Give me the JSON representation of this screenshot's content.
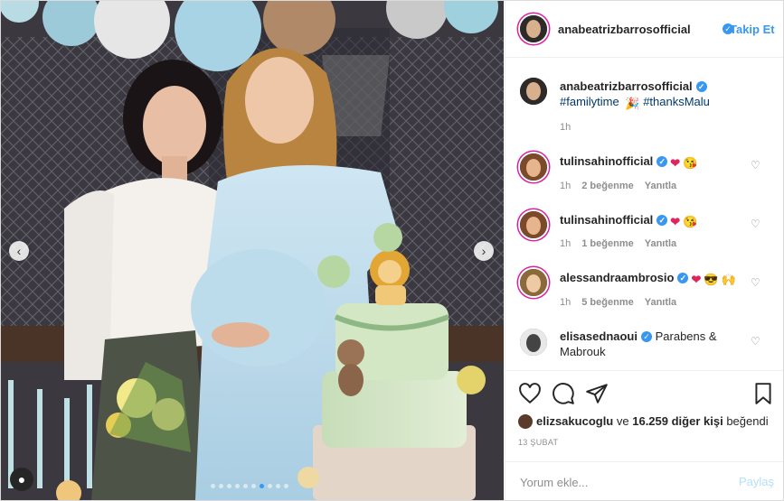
{
  "post": {
    "author": "anabeatrizbarrosofficial",
    "follow_label": "Takip Et",
    "caption_tags": [
      "#familytime",
      "#thanksMalu"
    ],
    "caption_time": "1h",
    "likes_user": "elizsakucoglu",
    "likes_middle": "ve",
    "likes_count": "16.259 diğer kişi",
    "likes_suffix": "beğendi",
    "date": "13 ŞUBAT",
    "comment_placeholder": "Yorum ekle...",
    "post_label": "Paylaş"
  },
  "comments": [
    {
      "user": "tulinsahinofficial",
      "time": "1h",
      "likes": "2 beğenme",
      "reply": "Yanıtla"
    },
    {
      "user": "tulinsahinofficial",
      "time": "1h",
      "likes": "1 beğenme",
      "reply": "Yanıtla"
    },
    {
      "user": "alessandraambrosio",
      "time": "1h",
      "likes": "5 beğenme",
      "reply": "Yanıtla"
    },
    {
      "user": "elisasednaoui",
      "text": "Parabens & Mabrouk"
    }
  ],
  "icons": {
    "verified": "verified-badge-icon",
    "heart": "heart-icon",
    "comment": "comment-bubble-icon",
    "share": "paper-plane-icon",
    "save": "bookmark-icon",
    "user_tag": "user-tag-icon",
    "prev": "chevron-left-icon",
    "next": "chevron-right-icon"
  },
  "colors": {
    "accent": "#3897f0",
    "text": "#262626",
    "muted": "#8e8e8e"
  }
}
